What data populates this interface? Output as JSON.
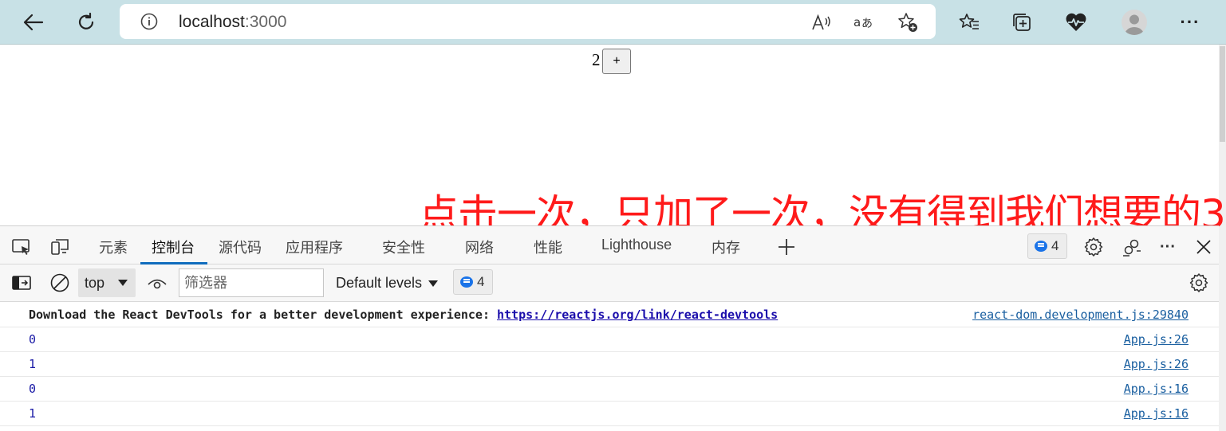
{
  "browser": {
    "url_host": "localhost",
    "url_port": ":3000",
    "icons": [
      "back-arrow-icon",
      "refresh-icon",
      "site-info-icon",
      "read-aloud-icon",
      "translate-icon",
      "add-favorite-icon",
      "favorites-icon",
      "collections-icon",
      "health-icon",
      "profile-avatar",
      "more-icon"
    ]
  },
  "page": {
    "count": "2",
    "increment_label": "+",
    "annotation": "点击一次，只加了一次，没有得到我们想要的3",
    "annotation_color": "#ff1a1a"
  },
  "devtools": {
    "tabs": [
      {
        "label": "元素"
      },
      {
        "label": "控制台"
      },
      {
        "label": "源代码"
      },
      {
        "label": "应用程序"
      },
      {
        "label": "安全性"
      },
      {
        "label": "网络"
      },
      {
        "label": "性能"
      },
      {
        "label": "Lighthouse"
      },
      {
        "label": "内存"
      }
    ],
    "active_tab": "控制台",
    "issues_count": "4",
    "context": "top",
    "filter_placeholder": "筛选器",
    "levels_label": "Default levels",
    "messages_count": "4",
    "accent_color": "#0f6cbd"
  },
  "console": {
    "rows": [
      {
        "text": "Download the React DevTools for a better development experience: ",
        "link": "https://reactjs.org/link/react-devtools",
        "source": "react-dom.development.js:29840"
      },
      {
        "text": "0",
        "source": "App.js:26"
      },
      {
        "text": "1",
        "source": "App.js:26"
      },
      {
        "text": "0",
        "source": "App.js:16"
      },
      {
        "text": "1",
        "source": "App.js:16"
      }
    ]
  }
}
